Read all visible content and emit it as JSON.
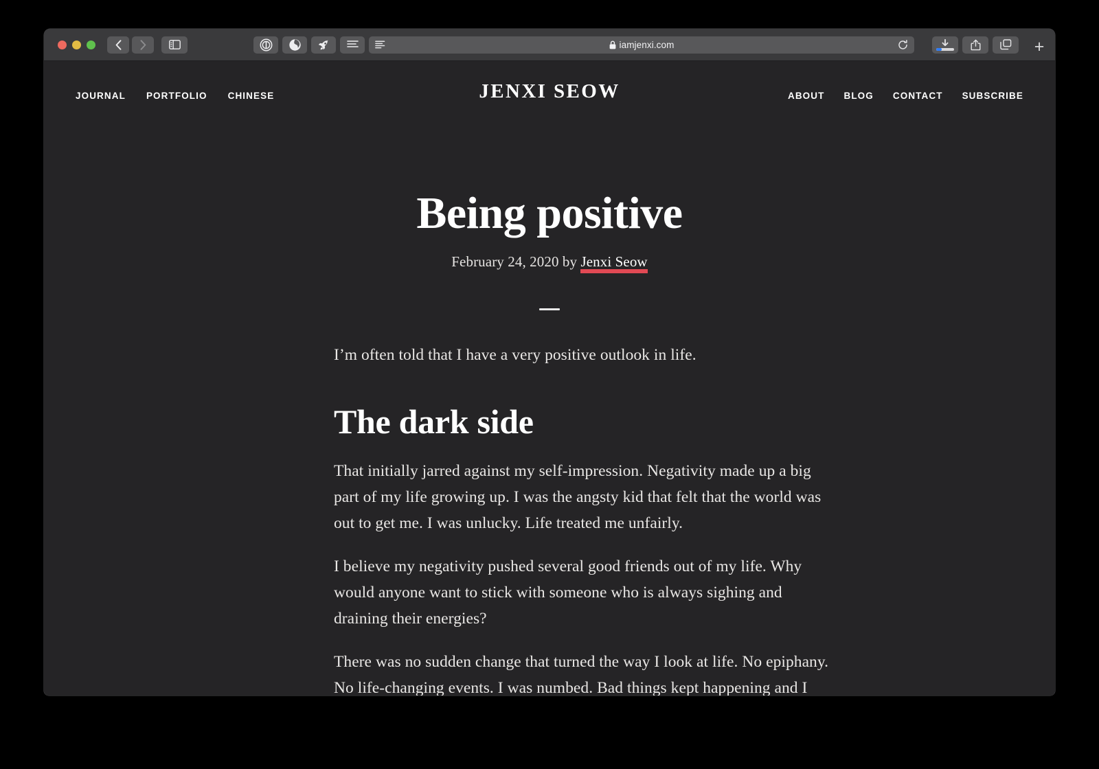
{
  "browser": {
    "window_controls": {
      "close": "close-window",
      "minimize": "minimize-window",
      "maximize": "maximize-window"
    },
    "back_label": "‹",
    "forward_label": "›",
    "url": "iamjenxi.com",
    "lock_icon": "lock-icon",
    "reader_icon": "reader-view-icon",
    "reload_icon": "reload-icon",
    "sidebar_icon": "sidebar-icon",
    "extensions": [
      {
        "name": "onepassword-extension-icon",
        "glyph": "1"
      },
      {
        "name": "ghostery-extension-icon",
        "glyph": ""
      },
      {
        "name": "rocket-extension-icon",
        "glyph": ""
      },
      {
        "name": "reader-extension-icon",
        "glyph": ""
      }
    ],
    "download_icon": "downloads-icon",
    "download_progress_percent": 30,
    "share_icon": "share-icon",
    "tabs_icon": "tab-overview-icon",
    "new_tab_label": "+",
    "accent_color": "#2f7cf6"
  },
  "site": {
    "title": "JENXI SEOW",
    "nav_left": [
      {
        "label": "JOURNAL"
      },
      {
        "label": "PORTFOLIO"
      },
      {
        "label": "CHINESE"
      }
    ],
    "nav_right": [
      {
        "label": "ABOUT"
      },
      {
        "label": "BLOG"
      },
      {
        "label": "CONTACT"
      },
      {
        "label": "SUBSCRIBE"
      }
    ],
    "background_color": "#252426",
    "link_underline_color": "#e14954"
  },
  "article": {
    "title": "Being positive",
    "date": "February 24, 2020",
    "byline_prefix": "February 24, 2020 by ",
    "author": "Jenxi Seow",
    "divider": "—",
    "lede": "I’m often told that I have a very positive outlook in life.",
    "section_heading": "The dark side",
    "paragraphs": [
      "That initially jarred against my self-impression. Negativity made up a big part of my life growing up. I was the angsty kid that felt that the world was out to get me. I was unlucky. Life treated me unfairly.",
      "I believe my negativity pushed several good friends out of my life. Why would anyone want to stick with someone who is always sighing and draining their energies?",
      "There was no sudden change that turned the way I look at life. No epiphany. No life-changing events. I was numbed. Bad things kept happening and I became so desensitised that I just took them as they"
    ]
  }
}
